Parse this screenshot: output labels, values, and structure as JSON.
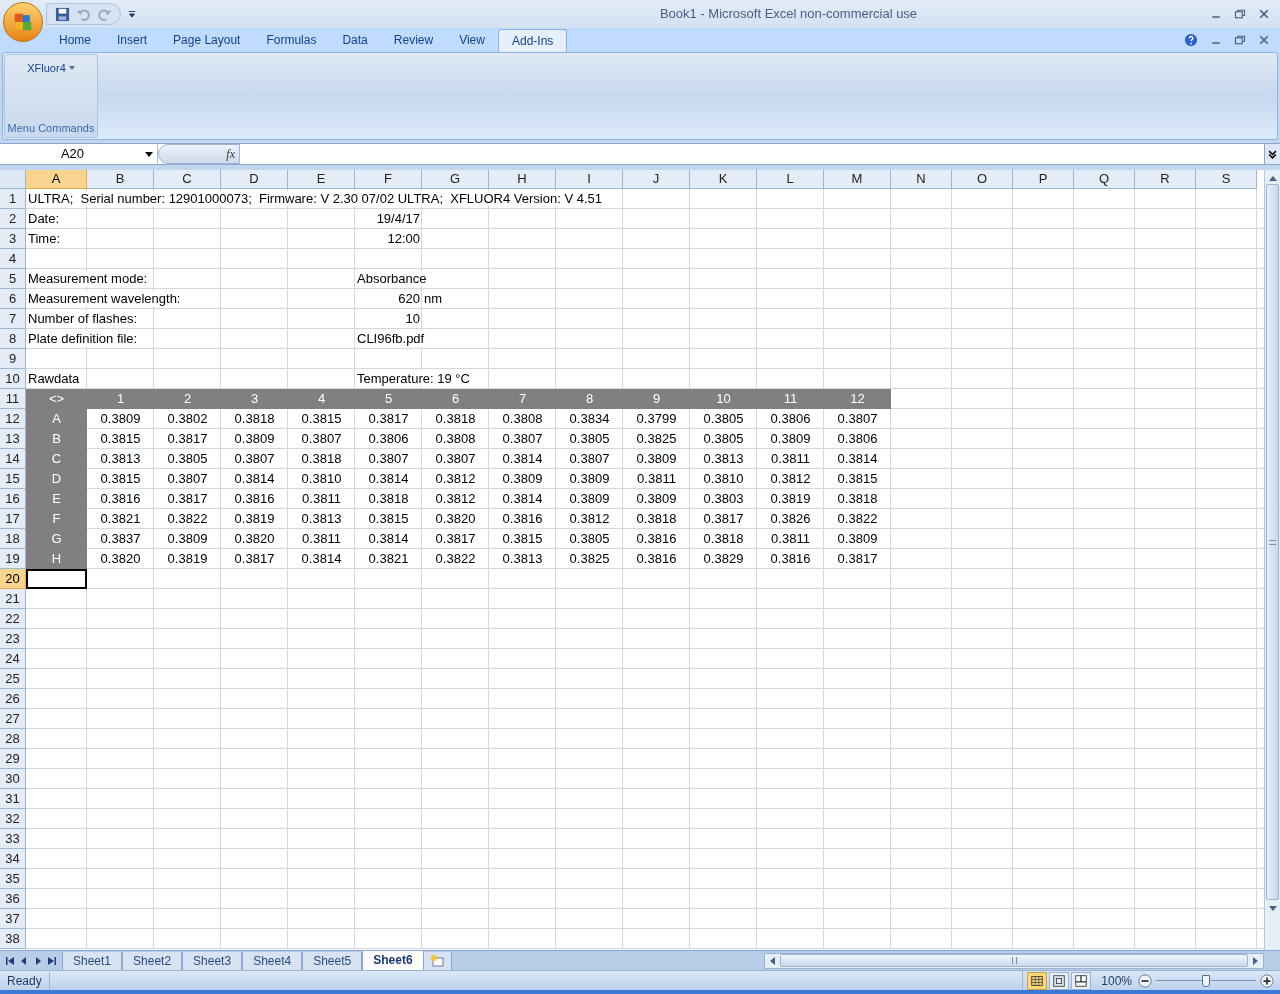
{
  "window": {
    "title": "Book1 - Microsoft Excel non-commercial use"
  },
  "ribbon_tabs": [
    {
      "label": "Home",
      "selected": false
    },
    {
      "label": "Insert",
      "selected": false
    },
    {
      "label": "Page Layout",
      "selected": false
    },
    {
      "label": "Formulas",
      "selected": false
    },
    {
      "label": "Data",
      "selected": false
    },
    {
      "label": "Review",
      "selected": false
    },
    {
      "label": "View",
      "selected": false
    },
    {
      "label": "Add-Ins",
      "selected": true
    }
  ],
  "ribbon": {
    "group_label": "Menu Commands",
    "button": "XFluor4"
  },
  "formula_bar": {
    "name_box": "A20",
    "fx": "fx"
  },
  "columns": [
    {
      "label": "A",
      "selected": true
    },
    {
      "label": "B",
      "selected": false
    },
    {
      "label": "C",
      "selected": false
    },
    {
      "label": "D",
      "selected": false
    },
    {
      "label": "E",
      "selected": false
    },
    {
      "label": "F",
      "selected": false
    },
    {
      "label": "G",
      "selected": false
    },
    {
      "label": "H",
      "selected": false
    },
    {
      "label": "I",
      "selected": false
    },
    {
      "label": "J",
      "selected": false
    },
    {
      "label": "K",
      "selected": false
    },
    {
      "label": "L",
      "selected": false
    },
    {
      "label": "M",
      "selected": false
    },
    {
      "label": "N",
      "selected": false
    },
    {
      "label": "O",
      "selected": false
    },
    {
      "label": "P",
      "selected": false
    },
    {
      "label": "Q",
      "selected": false
    },
    {
      "label": "R",
      "selected": false
    },
    {
      "label": "S",
      "selected": false
    }
  ],
  "rows": [
    {
      "number": "1",
      "selected": false,
      "kind": "info",
      "label": "ULTRA;  Serial number: 12901000073;  Firmware: V 2.30 07/02 ULTRA;  XFLUOR4 Version: V 4.51"
    },
    {
      "number": "2",
      "selected": false,
      "kind": "info",
      "label": "Date:",
      "value": "19/4/17",
      "numeric": true
    },
    {
      "number": "3",
      "selected": false,
      "kind": "info",
      "label": "Time:",
      "value": "12:00",
      "numeric": true
    },
    {
      "number": "4",
      "selected": false,
      "kind": "empty"
    },
    {
      "number": "5",
      "selected": false,
      "kind": "info",
      "label": "Measurement mode:",
      "value": "Absorbance",
      "numeric": false
    },
    {
      "number": "6",
      "selected": false,
      "kind": "info",
      "label": "Measurement wavelength:",
      "value": "620",
      "numeric": true,
      "unit": "nm"
    },
    {
      "number": "7",
      "selected": false,
      "kind": "info",
      "label": "Number of flashes:",
      "value": "10",
      "numeric": true
    },
    {
      "number": "8",
      "selected": false,
      "kind": "info",
      "label": "Plate definition file:",
      "value": "CLI96fb.pdf",
      "numeric": false
    },
    {
      "number": "9",
      "selected": false,
      "kind": "empty"
    },
    {
      "number": "10",
      "selected": false,
      "kind": "info",
      "label": "Rawdata",
      "value": "Temperature: 19 °C",
      "numeric": false
    },
    {
      "number": "11",
      "selected": false,
      "kind": "plate_header",
      "label": "<>",
      "values": [
        "1",
        "2",
        "3",
        "4",
        "5",
        "6",
        "7",
        "8",
        "9",
        "10",
        "11",
        "12"
      ]
    },
    {
      "number": "12",
      "selected": false,
      "kind": "plate",
      "label": "A",
      "values": [
        "0.3809",
        "0.3802",
        "0.3818",
        "0.3815",
        "0.3817",
        "0.3818",
        "0.3808",
        "0.3834",
        "0.3799",
        "0.3805",
        "0.3806",
        "0.3807"
      ]
    },
    {
      "number": "13",
      "selected": false,
      "kind": "plate",
      "label": "B",
      "values": [
        "0.3815",
        "0.3817",
        "0.3809",
        "0.3807",
        "0.3806",
        "0.3808",
        "0.3807",
        "0.3805",
        "0.3825",
        "0.3805",
        "0.3809",
        "0.3806"
      ]
    },
    {
      "number": "14",
      "selected": false,
      "kind": "plate",
      "label": "C",
      "values": [
        "0.3813",
        "0.3805",
        "0.3807",
        "0.3818",
        "0.3807",
        "0.3807",
        "0.3814",
        "0.3807",
        "0.3809",
        "0.3813",
        "0.3811",
        "0.3814"
      ]
    },
    {
      "number": "15",
      "selected": false,
      "kind": "plate",
      "label": "D",
      "values": [
        "0.3815",
        "0.3807",
        "0.3814",
        "0.3810",
        "0.3814",
        "0.3812",
        "0.3809",
        "0.3809",
        "0.3811",
        "0.3810",
        "0.3812",
        "0.3815"
      ]
    },
    {
      "number": "16",
      "selected": false,
      "kind": "plate",
      "label": "E",
      "values": [
        "0.3816",
        "0.3817",
        "0.3816",
        "0.3811",
        "0.3818",
        "0.3812",
        "0.3814",
        "0.3809",
        "0.3809",
        "0.3803",
        "0.3819",
        "0.3818"
      ]
    },
    {
      "number": "17",
      "selected": false,
      "kind": "plate",
      "label": "F",
      "values": [
        "0.3821",
        "0.3822",
        "0.3819",
        "0.3813",
        "0.3815",
        "0.3820",
        "0.3816",
        "0.3812",
        "0.3818",
        "0.3817",
        "0.3826",
        "0.3822"
      ]
    },
    {
      "number": "18",
      "selected": false,
      "kind": "plate",
      "label": "G",
      "values": [
        "0.3837",
        "0.3809",
        "0.3820",
        "0.3811",
        "0.3814",
        "0.3817",
        "0.3815",
        "0.3805",
        "0.3816",
        "0.3818",
        "0.3811",
        "0.3809"
      ]
    },
    {
      "number": "19",
      "selected": false,
      "kind": "plate",
      "label": "H",
      "values": [
        "0.3820",
        "0.3819",
        "0.3817",
        "0.3814",
        "0.3821",
        "0.3822",
        "0.3813",
        "0.3825",
        "0.3816",
        "0.3829",
        "0.3816",
        "0.3817"
      ]
    },
    {
      "number": "20",
      "selected": true,
      "kind": "empty"
    },
    {
      "number": "21",
      "selected": false,
      "kind": "empty"
    },
    {
      "number": "22",
      "selected": false,
      "kind": "empty"
    },
    {
      "number": "23",
      "selected": false,
      "kind": "empty"
    },
    {
      "number": "24",
      "selected": false,
      "kind": "empty"
    },
    {
      "number": "25",
      "selected": false,
      "kind": "empty"
    },
    {
      "number": "26",
      "selected": false,
      "kind": "empty"
    },
    {
      "number": "27",
      "selected": false,
      "kind": "empty"
    },
    {
      "number": "28",
      "selected": false,
      "kind": "empty"
    },
    {
      "number": "29",
      "selected": false,
      "kind": "empty"
    },
    {
      "number": "30",
      "selected": false,
      "kind": "empty"
    },
    {
      "number": "31",
      "selected": false,
      "kind": "empty"
    },
    {
      "number": "32",
      "selected": false,
      "kind": "empty"
    },
    {
      "number": "33",
      "selected": false,
      "kind": "empty"
    },
    {
      "number": "34",
      "selected": false,
      "kind": "empty"
    },
    {
      "number": "35",
      "selected": false,
      "kind": "empty"
    },
    {
      "number": "36",
      "selected": false,
      "kind": "empty"
    },
    {
      "number": "37",
      "selected": false,
      "kind": "empty"
    },
    {
      "number": "38",
      "selected": false,
      "kind": "empty"
    }
  ],
  "sheet_tabs": [
    {
      "label": "Sheet1",
      "selected": false
    },
    {
      "label": "Sheet2",
      "selected": false
    },
    {
      "label": "Sheet3",
      "selected": false
    },
    {
      "label": "Sheet4",
      "selected": false
    },
    {
      "label": "Sheet5",
      "selected": false
    },
    {
      "label": "Sheet6",
      "selected": true
    }
  ],
  "status_bar": {
    "text": "Ready",
    "views": [
      {
        "kind": "normal",
        "selected": true
      },
      {
        "kind": "page_layout",
        "selected": false
      },
      {
        "kind": "page_break",
        "selected": false
      }
    ],
    "zoom": "100%",
    "zoom_slider": {
      "level": 0.5
    }
  }
}
